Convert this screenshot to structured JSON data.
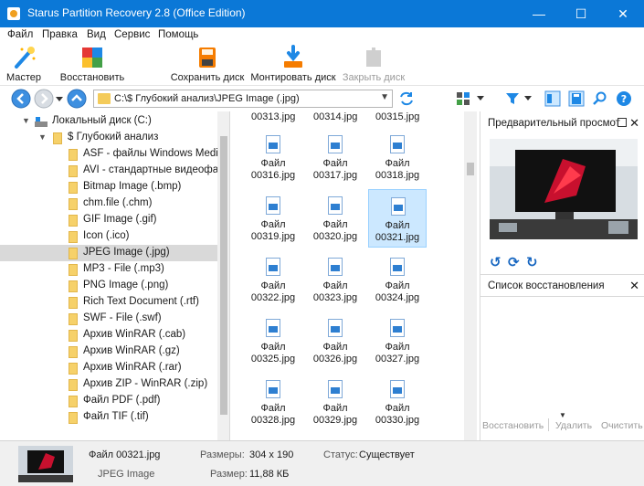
{
  "window": {
    "title": "Starus Partition Recovery 2.8 (Office Edition)",
    "minimize": "—",
    "maximize": "☐",
    "close": "✕"
  },
  "menu": [
    "Файл",
    "Правка",
    "Вид",
    "Сервис",
    "Помощь"
  ],
  "toolbar": {
    "wizard": "Мастер",
    "restore": "Восстановить",
    "save_disk": "Сохранить диск",
    "mount_disk": "Монтировать диск",
    "close_disk": "Закрыть диск"
  },
  "address": {
    "path": "C:\\$ Глубокий анализ\\JPEG Image (.jpg)"
  },
  "tree": {
    "drive": "Локальный диск (C:)",
    "deep": "$ Глубокий анализ",
    "items": [
      "ASF - файлы Windows Media (",
      "AVI - стандартные видеофайл",
      "Bitmap Image (.bmp)",
      "chm.file (.chm)",
      "GIF Image (.gif)",
      "Icon (.ico)",
      "JPEG Image (.jpg)",
      "MP3 - File (.mp3)",
      "PNG Image (.png)",
      "Rich Text Document (.rtf)",
      "SWF - File (.swf)",
      "Архив WinRAR (.cab)",
      "Архив WinRAR (.gz)",
      "Архив WinRAR (.rar)",
      "Архив ZIP - WinRAR (.zip)",
      "Файл PDF (.pdf)",
      "Файл TIF (.tif)"
    ]
  },
  "grid": {
    "top_row": [
      "00313.jpg",
      "00314.jpg",
      "00315.jpg"
    ],
    "prefix": "Файл",
    "files": [
      "00316.jpg",
      "00317.jpg",
      "00318.jpg",
      "00319.jpg",
      "00320.jpg",
      "00321.jpg",
      "00322.jpg",
      "00323.jpg",
      "00324.jpg",
      "00325.jpg",
      "00326.jpg",
      "00327.jpg",
      "00328.jpg",
      "00329.jpg",
      "00330.jpg"
    ]
  },
  "preview": {
    "title": "Предварительный просмот"
  },
  "recovery_list": {
    "title": "Список восстановления",
    "restore": "Восстановить",
    "delete": "Удалить",
    "clear": "Очистить"
  },
  "status": {
    "filename": "Файл 00321.jpg",
    "type": "JPEG Image",
    "dims_label": "Размеры:",
    "dims_value": "304 x 190",
    "size_label": "Размер:",
    "size_value": "11,88 КБ",
    "status_label": "Статус:",
    "status_value": "Существует"
  }
}
